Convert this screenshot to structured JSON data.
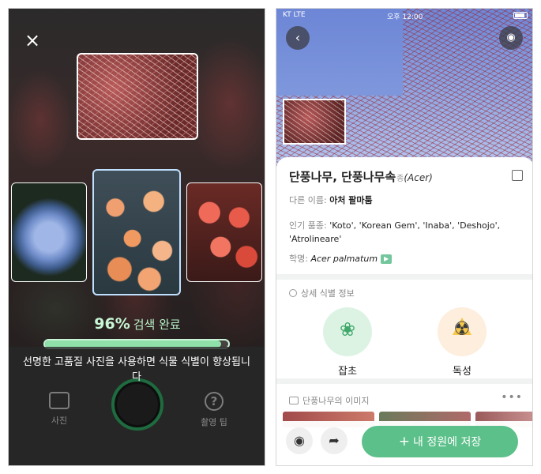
{
  "left_screen": {
    "close_label": "×",
    "progress": {
      "percent_text": "96%",
      "label": "검색 완료",
      "value": 0.96
    },
    "tip": "선명한 고품질 사진을 사용하면 식물 식별이 향상됩니다",
    "bottom": {
      "photo_label": "사진",
      "tips_label": "촬영 팁"
    }
  },
  "right_screen": {
    "status": {
      "carrier": "KT  LTE",
      "time": "오후 12:00"
    },
    "title": {
      "name": "단풍나무",
      "genus": "단풍나무속",
      "rank": "종",
      "latin": "(Acer)"
    },
    "other_names": {
      "label": "다른 이름:",
      "value": "아처 팔마툼"
    },
    "cultivars": {
      "label": "인기 품종:",
      "value": "'Koto', 'Korean Gem', 'Inaba', 'Deshojo', 'Atrolineare'"
    },
    "scientific": {
      "label": "학명:",
      "value": "Acer palmatum"
    },
    "detail_section": "상세 식별 정보",
    "features": [
      {
        "label": "잡초"
      },
      {
        "label": "독성"
      }
    ],
    "images_section": "단풍나무의 이미지",
    "save_button": "내 정원에 저장"
  },
  "colors": {
    "accent_green": "#5cc08a",
    "progress_text": "#b6f0c8",
    "weed_bg": "#dcf3e4",
    "toxic_bg": "#fdeede"
  },
  "icons": [
    "close-icon",
    "photo-icon",
    "help-icon",
    "shutter-button",
    "back-icon",
    "camera-icon",
    "edit-icon",
    "speaker-icon",
    "search-icon",
    "grass-icon",
    "toxic-icon",
    "image-icon",
    "more-icon",
    "share-icon",
    "plus-icon"
  ]
}
